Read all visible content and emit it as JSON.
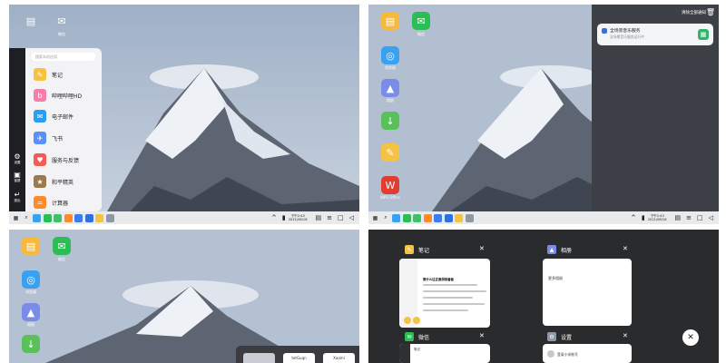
{
  "desktop": {
    "icons": [
      {
        "label": "",
        "glyph": "▤",
        "color": "#f6b93b",
        "icon": "folder-icon"
      },
      {
        "label": "微信",
        "glyph": "✉",
        "color": "#2dbd55",
        "icon": "wechat-icon"
      },
      {
        "label": "浏览器",
        "glyph": "◎",
        "color": "#3aa0f0",
        "icon": "browser-icon"
      },
      {
        "label": "相册",
        "glyph": "▲",
        "color": "#7b8ce8",
        "icon": "gallery-icon"
      },
      {
        "label": "",
        "glyph": "↓",
        "color": "#5ac15a",
        "icon": "download-icon"
      },
      {
        "label": "笔记",
        "glyph": "✎",
        "color": "#f5c242",
        "icon": "notes-icon"
      },
      {
        "label": "WPS Office",
        "glyph": "W",
        "color": "#e23b31",
        "icon": "wps-icon"
      }
    ]
  },
  "taskbar": {
    "time": "下午2:43",
    "date": "2021/08/18",
    "pins": [
      {
        "icon": "start-grid-icon",
        "glyph": "▦",
        "color": "transparent"
      },
      {
        "icon": "search-icon",
        "glyph": "⌕",
        "color": "transparent"
      },
      {
        "icon": "browser-icon",
        "glyph": "",
        "color": "#3aa0f0"
      },
      {
        "icon": "wechat-icon",
        "glyph": "",
        "color": "#2dbd55"
      },
      {
        "icon": "messages-icon",
        "glyph": "",
        "color": "#40c06a"
      },
      {
        "icon": "xiaomi-store-icon",
        "glyph": "",
        "color": "#ff8a2b"
      },
      {
        "icon": "tencent-video-icon",
        "glyph": "",
        "color": "#3b7cf1"
      },
      {
        "icon": "app-icon",
        "glyph": "",
        "color": "#2f6fe0"
      },
      {
        "icon": "notes-icon",
        "glyph": "",
        "color": "#f5c242"
      },
      {
        "icon": "settings-icon",
        "glyph": "",
        "color": "#8e98a6"
      }
    ]
  },
  "start_menu": {
    "search_placeholder": "搜索本机应用",
    "items": [
      {
        "label": "笔记",
        "glyph": "✎",
        "color": "#f5c242",
        "icon": "notes-icon"
      },
      {
        "label": "哔哩哔哩HD",
        "glyph": "b",
        "color": "#f77eaa",
        "icon": "bilibili-icon"
      },
      {
        "label": "电子邮件",
        "glyph": "✉",
        "color": "#2a9df4",
        "icon": "mail-icon"
      },
      {
        "label": "飞书",
        "glyph": "✈",
        "color": "#5b8ff9",
        "icon": "feishu-icon"
      },
      {
        "label": "服务与反馈",
        "glyph": "♥",
        "color": "#f25c54",
        "icon": "feedback-icon"
      },
      {
        "label": "和平精英",
        "glyph": "★",
        "color": "#9a7a4e",
        "icon": "game-icon"
      },
      {
        "label": "计算器",
        "glyph": "=",
        "color": "#ff8a2b",
        "icon": "calculator-icon"
      }
    ],
    "side": [
      {
        "label": "设置",
        "glyph": "⚙",
        "icon": "gear-icon"
      },
      {
        "label": "锁屏",
        "glyph": "▣",
        "icon": "lock-icon"
      },
      {
        "label": "退出",
        "glyph": "↵",
        "icon": "exit-icon"
      }
    ]
  },
  "notifications": {
    "clear_all": "清除全部通知",
    "card": {
      "title": "全场景音乐服务",
      "subtitle": "全场景音乐服务运行中"
    }
  },
  "recents": {
    "thumbs": [
      "",
      "tetGuqn",
      "Xaomi"
    ]
  },
  "multitask": {
    "cards": [
      {
        "label": "笔记",
        "icon": "notes-icon",
        "color": "#f5c242",
        "glyph": "✎"
      },
      {
        "label": "相册",
        "icon": "gallery-icon",
        "color": "#7b8ce8",
        "glyph": "▲"
      },
      {
        "label": "微信",
        "icon": "wechat-icon",
        "color": "#2dbd55",
        "glyph": "✉"
      },
      {
        "label": "设置",
        "icon": "gear-icon",
        "color": "#8e98a6",
        "glyph": "⚙"
      }
    ],
    "note_title": "微什么往言面洞相看看",
    "gallery_text": "更多相册",
    "wechat_text": "笔记",
    "settings_text": "登录小米账号"
  }
}
